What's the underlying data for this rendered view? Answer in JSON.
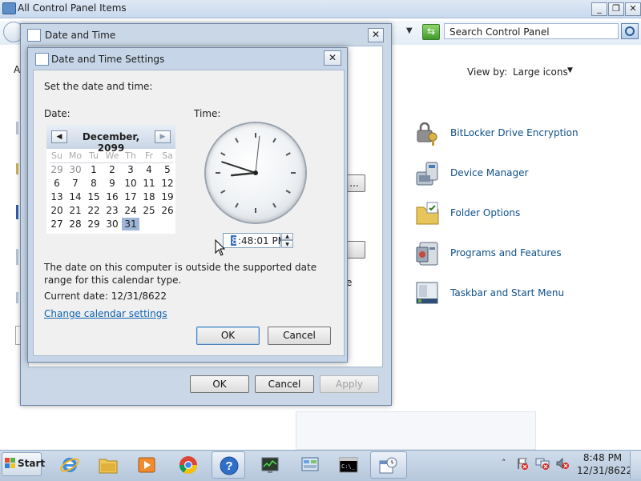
{
  "control_panel": {
    "title": "All Control Panel Items",
    "search_placeholder": "Search Control Panel",
    "view_by_label": "View by:",
    "view_by_value": "Large icons",
    "items": [
      {
        "label": "BitLocker Drive Encryption",
        "icon": "bitlocker-icon"
      },
      {
        "label": "Device Manager",
        "icon": "device-manager-icon"
      },
      {
        "label": "Folder Options",
        "icon": "folder-options-icon"
      },
      {
        "label": "Programs and Features",
        "icon": "programs-features-icon"
      },
      {
        "label": "Taskbar and Start Menu",
        "icon": "taskbar-start-menu-icon"
      }
    ],
    "partial_letter": "A",
    "partial_e": "e"
  },
  "date_time_dialog": {
    "title": "Date and Time",
    "ok_label": "OK",
    "cancel_label": "Cancel",
    "apply_label": "Apply",
    "hidden_button_label": "..."
  },
  "settings_dialog": {
    "title": "Date and Time Settings",
    "heading": "Set the date and time:",
    "date_label": "Date:",
    "time_label": "Time:",
    "calendar": {
      "month_label": "December, 2099",
      "days_of_week": [
        "Su",
        "Mo",
        "Tu",
        "We",
        "Th",
        "Fr",
        "Sa"
      ],
      "weeks": [
        [
          "29",
          "30",
          "1",
          "2",
          "3",
          "4",
          "5"
        ],
        [
          "6",
          "7",
          "8",
          "9",
          "10",
          "11",
          "12"
        ],
        [
          "13",
          "14",
          "15",
          "16",
          "17",
          "18",
          "19"
        ],
        [
          "20",
          "21",
          "22",
          "23",
          "24",
          "25",
          "26"
        ],
        [
          "27",
          "28",
          "29",
          "30",
          "31",
          "",
          ""
        ]
      ],
      "selected_day": "31"
    },
    "time_hour": "8",
    "time_rest": ":48:01 PM",
    "analog_clock": {
      "hour": 8,
      "minute": 48,
      "second": 1
    },
    "message": "The date on this computer is outside the supported date range for this calendar type.",
    "current_date": "Current date: 12/31/8622",
    "link_label": "Change calendar settings",
    "ok_label": "OK",
    "cancel_label": "Cancel"
  },
  "taskbar": {
    "start_label": "Start",
    "tray_chevron": "˄",
    "time": "8:48 PM",
    "date": "12/31/8622"
  },
  "colors": {
    "accent_link": "#0e62b3",
    "selected_day": "#9db6d8",
    "titlebar": "#c9d7e7"
  }
}
